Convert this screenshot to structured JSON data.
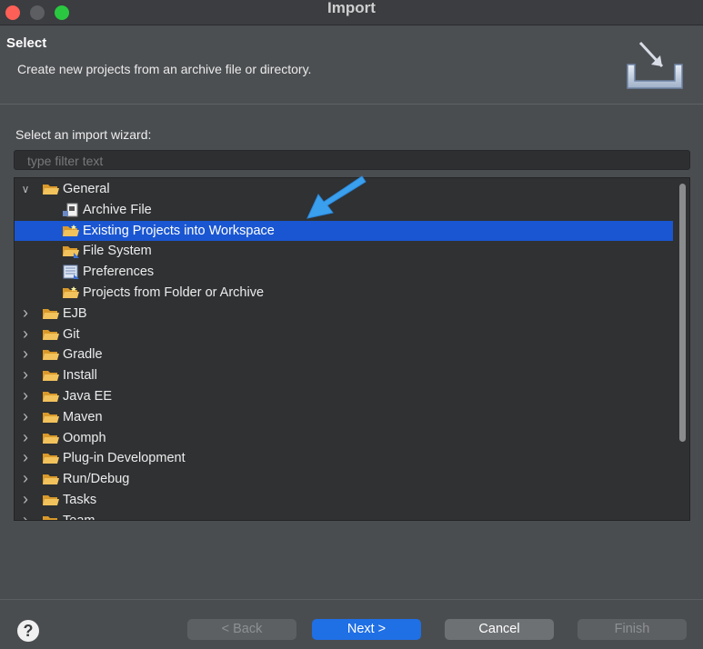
{
  "window": {
    "title": "Import"
  },
  "header": {
    "title": "Select",
    "description": "Create new projects from an archive file or directory."
  },
  "wizard": {
    "label": "Select an import wizard:",
    "filter_placeholder": "type filter text"
  },
  "tree": {
    "rows": [
      {
        "label": "General",
        "level": 0,
        "expanded": true,
        "icon": "folder-open-icon"
      },
      {
        "label": "Archive File",
        "level": 1,
        "icon": "archive-file-icon"
      },
      {
        "label": "Existing Projects into Workspace",
        "level": 1,
        "selected": true,
        "icon": "projects-folder-icon"
      },
      {
        "label": "File System",
        "level": 1,
        "icon": "file-system-folder-icon"
      },
      {
        "label": "Preferences",
        "level": 1,
        "icon": "preferences-icon"
      },
      {
        "label": "Projects from Folder or Archive",
        "level": 1,
        "icon": "projects-folder-icon"
      },
      {
        "label": "EJB",
        "level": 0,
        "expanded": false,
        "icon": "folder-open-icon"
      },
      {
        "label": "Git",
        "level": 0,
        "expanded": false,
        "icon": "folder-open-icon"
      },
      {
        "label": "Gradle",
        "level": 0,
        "expanded": false,
        "icon": "folder-open-icon"
      },
      {
        "label": "Install",
        "level": 0,
        "expanded": false,
        "icon": "folder-open-icon"
      },
      {
        "label": "Java EE",
        "level": 0,
        "expanded": false,
        "icon": "folder-open-icon"
      },
      {
        "label": "Maven",
        "level": 0,
        "expanded": false,
        "icon": "folder-open-icon"
      },
      {
        "label": "Oomph",
        "level": 0,
        "expanded": false,
        "icon": "folder-open-icon"
      },
      {
        "label": "Plug-in Development",
        "level": 0,
        "expanded": false,
        "icon": "folder-open-icon"
      },
      {
        "label": "Run/Debug",
        "level": 0,
        "expanded": false,
        "icon": "folder-open-icon"
      },
      {
        "label": "Tasks",
        "level": 0,
        "expanded": false,
        "icon": "folder-open-icon"
      },
      {
        "label": "Team",
        "level": 0,
        "expanded": false,
        "icon": "folder-open-icon"
      }
    ]
  },
  "footer": {
    "help_label": "?",
    "back_label": "< Back",
    "next_label": "Next >",
    "cancel_label": "Cancel",
    "finish_label": "Finish"
  },
  "colors": {
    "selection": "#1a56d1",
    "primary_button": "#1f6fe5",
    "annotation_arrow": "#3aa0ee",
    "folder": "#e8b04a"
  }
}
